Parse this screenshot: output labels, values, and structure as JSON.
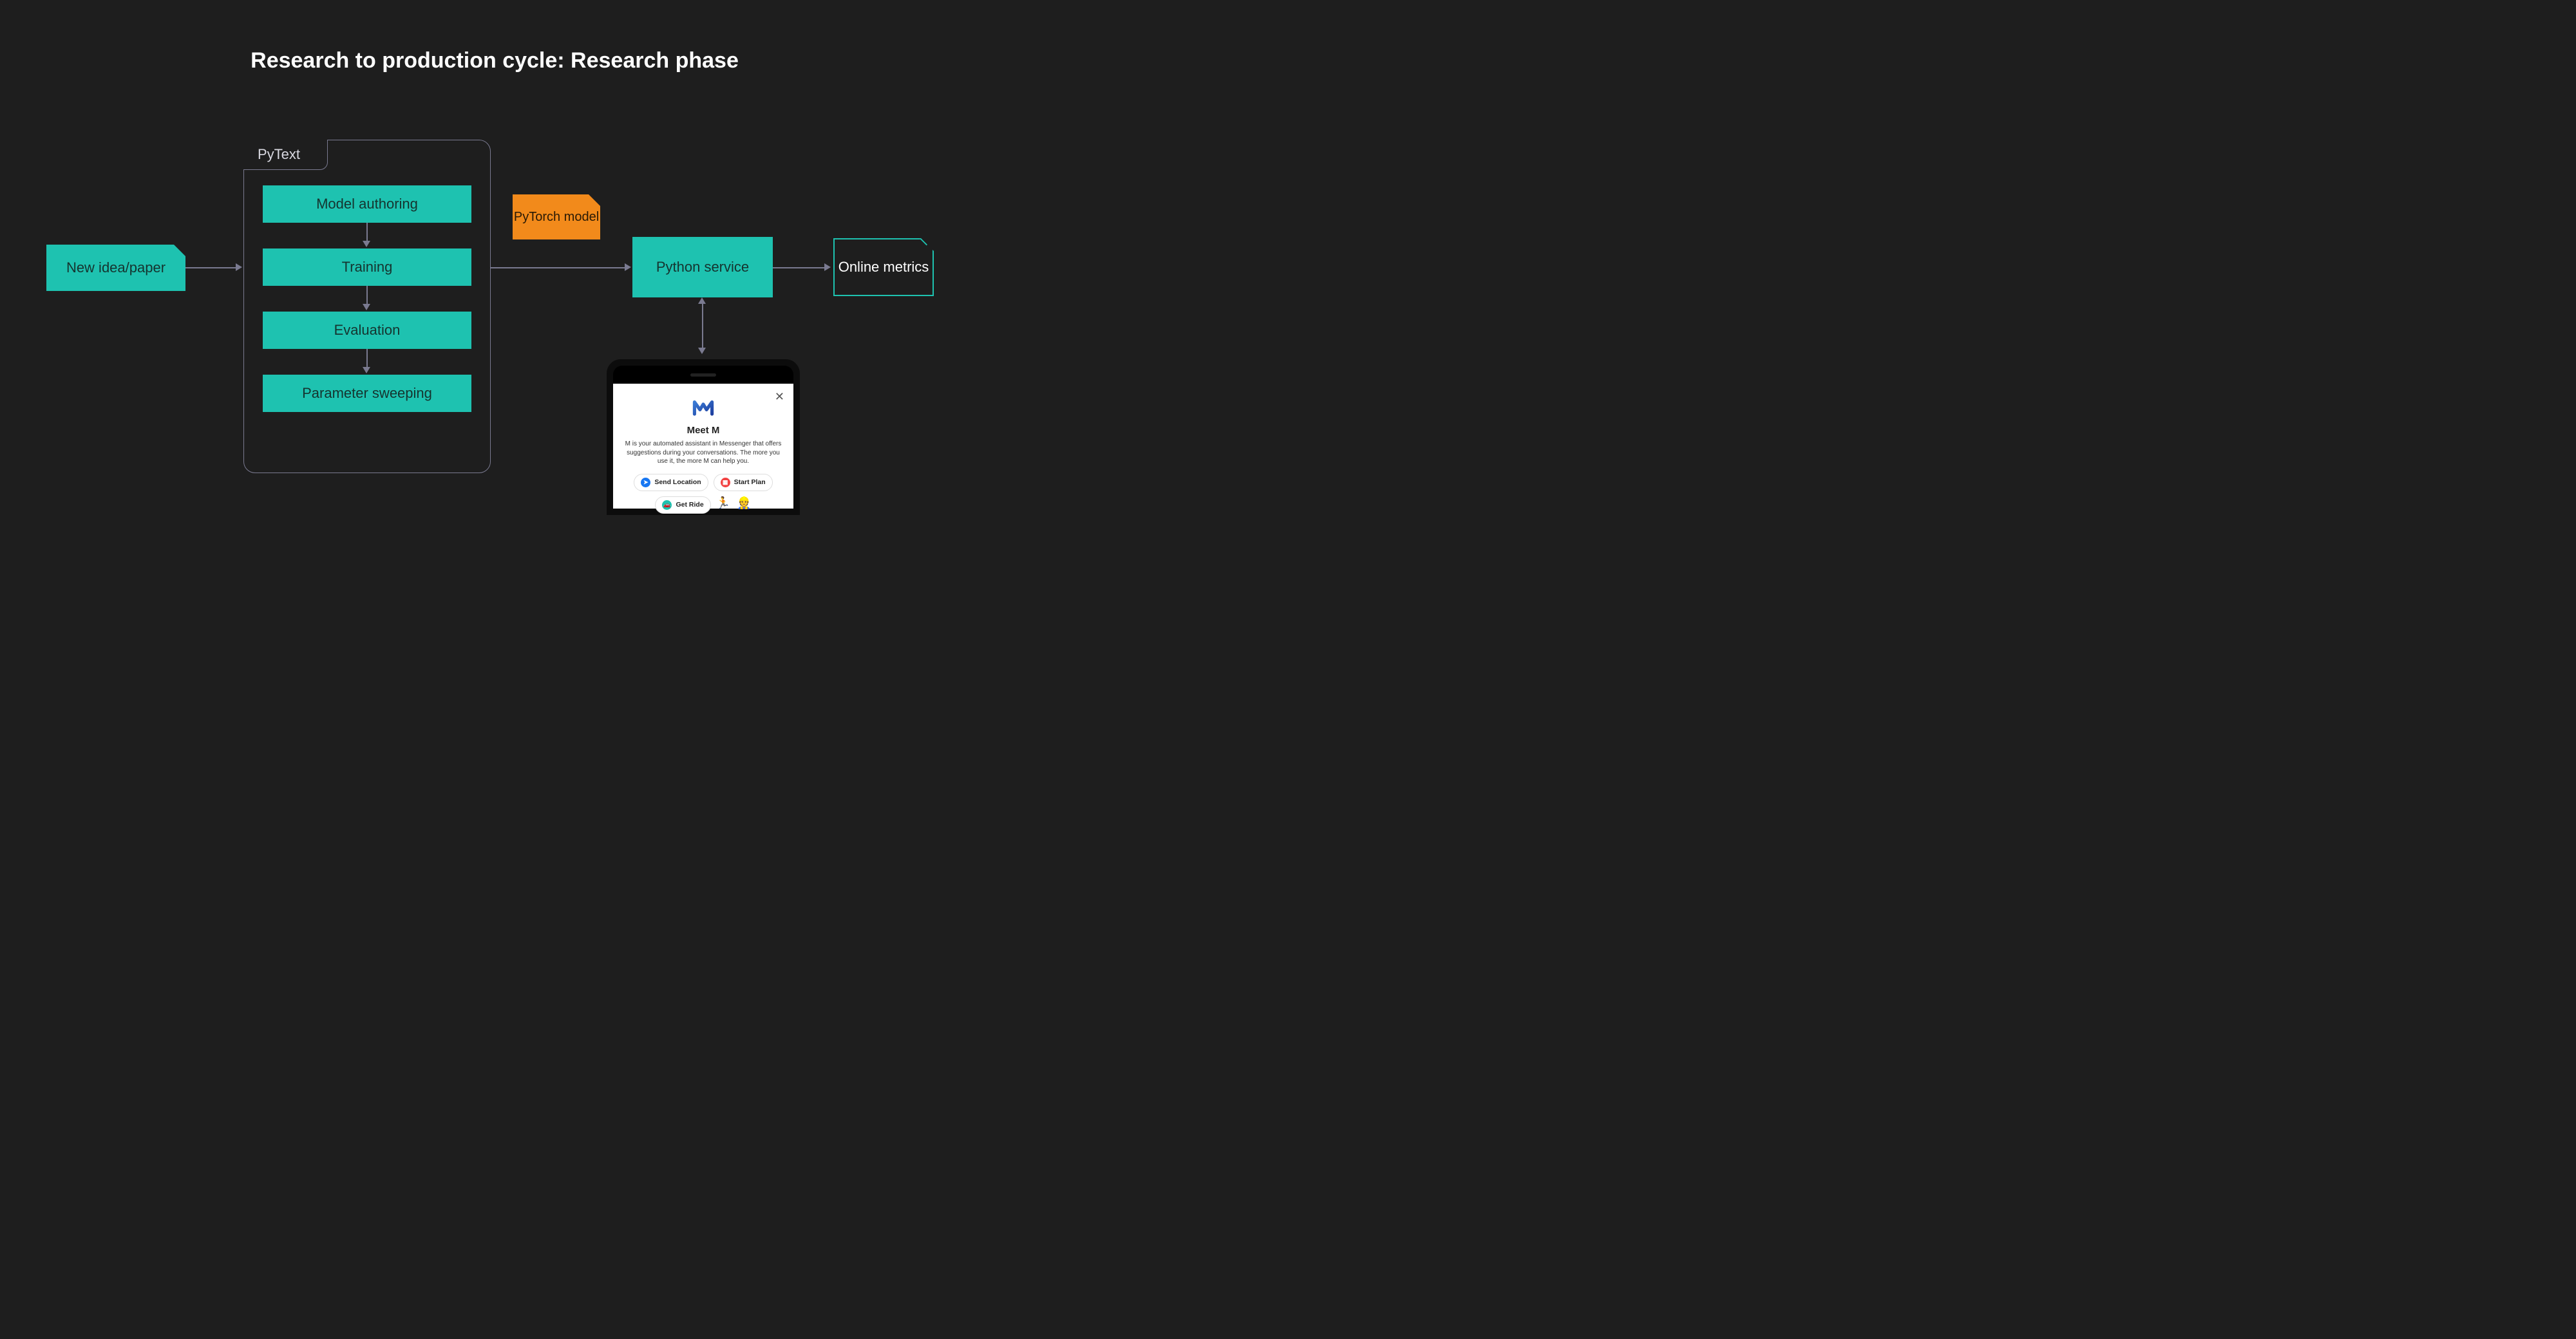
{
  "title": "Research to production cycle: Research phase",
  "nodes": {
    "new_idea": "New idea/paper",
    "pytext_label": "PyText",
    "steps": [
      "Model authoring",
      "Training",
      "Evaluation",
      "Parameter sweeping"
    ],
    "pytorch_model": "PyTorch model",
    "python_service": "Python service",
    "online_metrics": "Online metrics"
  },
  "phone": {
    "title": "Meet M",
    "desc": "M is your automated assistant in Messenger that offers suggestions during your conversations. The more you use it, the more M can help you.",
    "pills": {
      "send_location": "Send Location",
      "start_plan": "Start Plan",
      "get_ride": "Get Ride"
    }
  },
  "colors": {
    "bg": "#1e1e1e",
    "teal": "#1ec2b0",
    "orange": "#f28a1b",
    "arrow": "#7a7a90"
  }
}
